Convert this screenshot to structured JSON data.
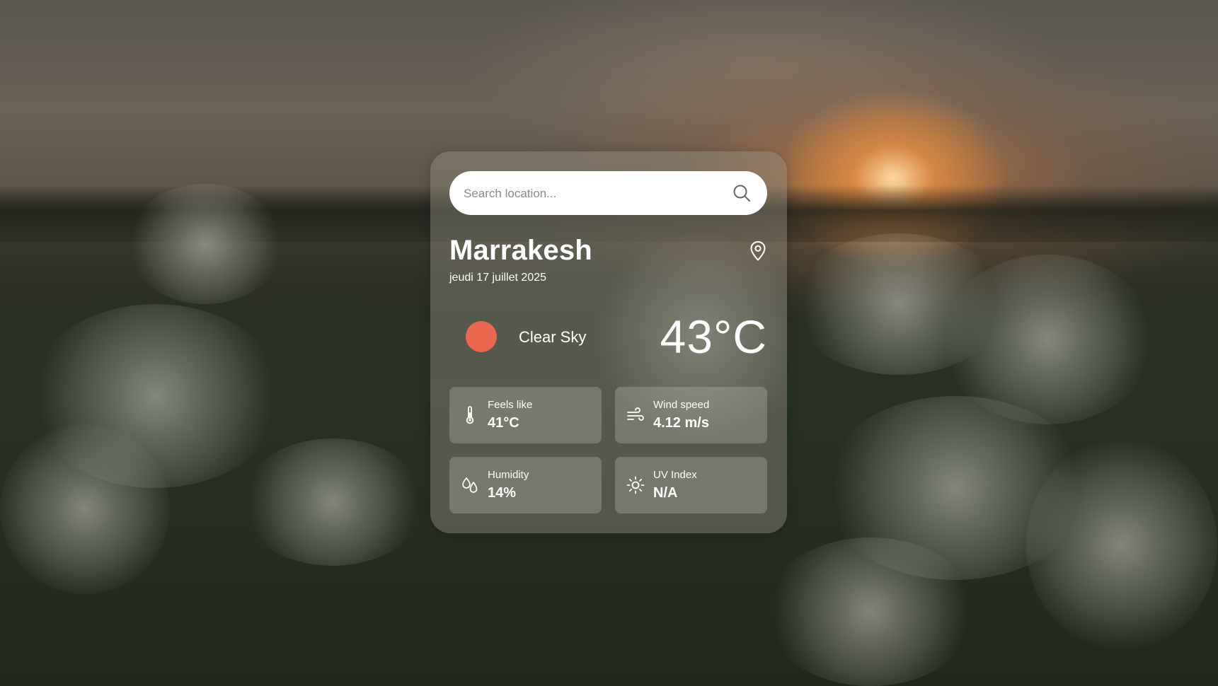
{
  "search": {
    "placeholder": "Search location..."
  },
  "location": {
    "city": "Marrakesh",
    "date": "jeudi 17 juillet 2025"
  },
  "current": {
    "condition": "Clear Sky",
    "temperature": "43°C",
    "condition_color": "#e8674e"
  },
  "stats": [
    {
      "label": "Feels like",
      "value": "41°C",
      "icon": "thermometer-icon"
    },
    {
      "label": "Wind speed",
      "value": "4.12 m/s",
      "icon": "wind-icon"
    },
    {
      "label": "Humidity",
      "value": "14%",
      "icon": "humidity-drops-icon"
    },
    {
      "label": "UV Index",
      "value": "N/A",
      "icon": "sun-icon"
    }
  ],
  "icons": {
    "search": "search-icon",
    "location": "map-pin-icon"
  }
}
